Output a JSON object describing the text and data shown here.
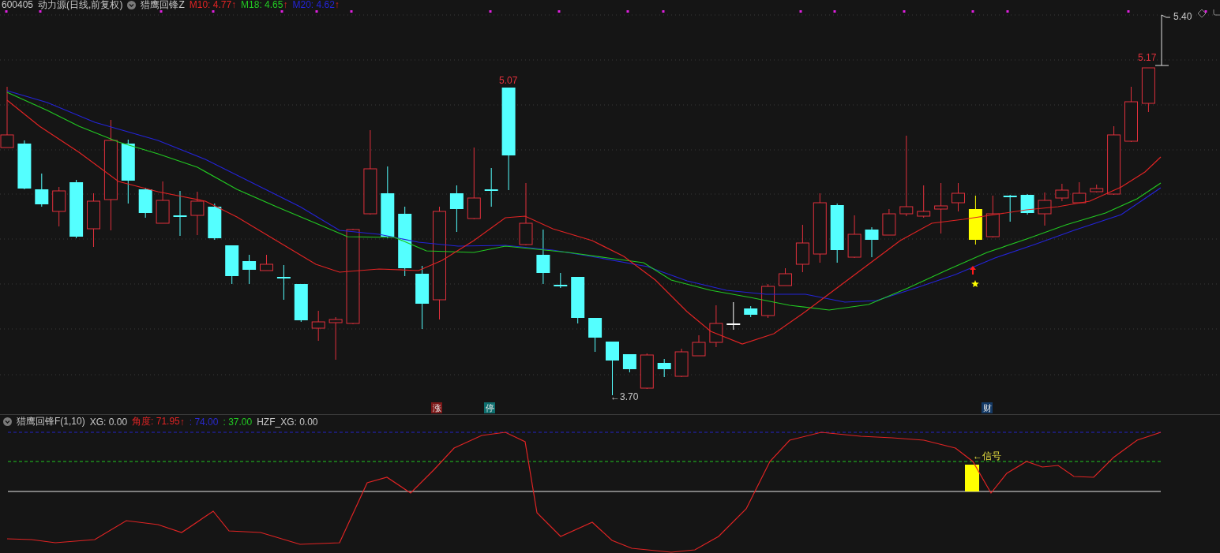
{
  "header": {
    "symbol": "600405",
    "title": "动力源(日线,前复权)",
    "indicator": "猎鹰回锋Z",
    "averages": [
      {
        "label": "M10: 4.77",
        "arrow": "↑",
        "color": "#e02424"
      },
      {
        "label": "M18: 4.65",
        "arrow": "↑",
        "color": "#22c822"
      },
      {
        "label": "M20: 4.62",
        "arrow": "↑",
        "color": "#2424d8"
      }
    ]
  },
  "main_chart": {
    "annotations": [
      {
        "kind": "peak",
        "text": "5.07"
      },
      {
        "kind": "trough",
        "text": "←3.70"
      },
      {
        "kind": "recent_high",
        "text": "5.17"
      },
      {
        "kind": "target",
        "text": "5.40"
      }
    ],
    "badges": [
      {
        "text": "涨",
        "color": "#7a1818"
      },
      {
        "text": "停",
        "color": "#0e6e6e"
      },
      {
        "text": "财",
        "color": "#143a66"
      }
    ]
  },
  "sub_chart": {
    "title": "猎鹰回锋F(1,10)",
    "values": [
      {
        "text": "XG: 0.00",
        "color": "#c8c8c8"
      },
      {
        "text": "角度: 71.95",
        "color": "#e02424",
        "arrow": "↑"
      },
      {
        "text": ": 74.00",
        "color": "#2a2ad0"
      },
      {
        "text": ": 37.00",
        "color": "#22c822"
      },
      {
        "text": "HZF_XG: 0.00",
        "color": "#c8c8c8"
      }
    ],
    "signal_label": "←信号"
  }
}
